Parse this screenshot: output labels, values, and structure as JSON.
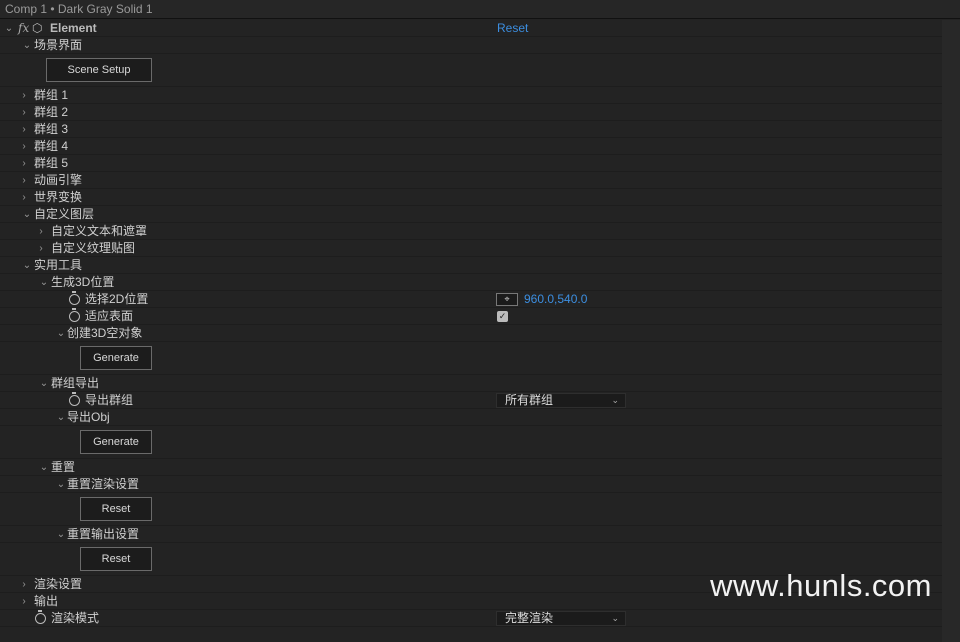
{
  "header": {
    "title": "Comp 1 • Dark Gray Solid 1"
  },
  "effect": {
    "fx": "fx",
    "name": "Element",
    "reset": "Reset"
  },
  "scene": {
    "label": "场景界面",
    "button": "Scene Setup"
  },
  "groups": [
    "群组 1",
    "群组 2",
    "群组 3",
    "群组 4",
    "群组 5"
  ],
  "animation_engine": "动画引擎",
  "world_transform": "世界变换",
  "custom_layers": {
    "label": "自定义图层",
    "items": [
      "自定义文本和遮罩",
      "自定义纹理贴图"
    ]
  },
  "utilities": {
    "label": "实用工具",
    "gen3d": {
      "label": "生成3D位置",
      "pick2d": "选择2D位置",
      "pick2d_value": "960.0,540.0",
      "fit_surface": "适应表面",
      "fit_surface_checked": true,
      "create_null": "创建3D空对象",
      "generate": "Generate"
    },
    "group_export": {
      "label": "群组导出",
      "export_group": "导出群组",
      "export_group_value": "所有群组",
      "export_obj": "导出Obj",
      "generate": "Generate"
    },
    "reset": {
      "label": "重置",
      "render_reset": "重置渲染设置",
      "render_reset_btn": "Reset",
      "output_reset": "重置输出设置",
      "output_reset_btn": "Reset"
    }
  },
  "render_settings": "渲染设置",
  "output": "输出",
  "render_mode": {
    "label": "渲染模式",
    "value": "完整渲染"
  },
  "watermark": "www.hunls.com"
}
